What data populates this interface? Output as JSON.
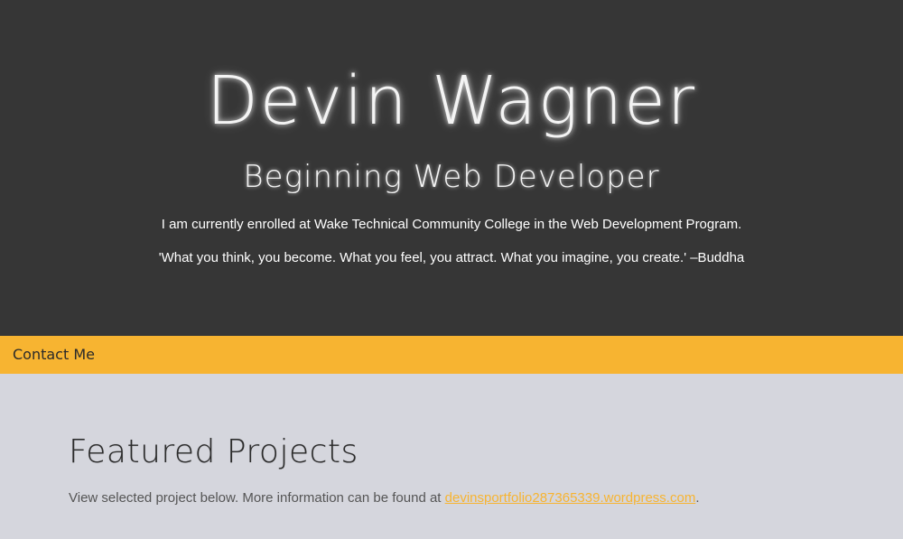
{
  "hero": {
    "name": "Devin Wagner",
    "subtitle": "Beginning Web Developer",
    "intro": "I am currently enrolled at Wake Technical Community College in the Web Development Program.",
    "quote": "'What you think, you become. What you feel, you attract. What you imagine, you create.' –Buddha"
  },
  "nav": {
    "contact_label": "Contact Me"
  },
  "projects": {
    "title": "Featured Projects",
    "desc_prefix": "View selected project below. More information can be found at ",
    "link_text": "devinsportfolio287365339.wordpress.com",
    "desc_suffix": "."
  },
  "colors": {
    "hero_bg": "#363636",
    "accent": "#f7b431",
    "section_bg": "#d5d6dd"
  }
}
